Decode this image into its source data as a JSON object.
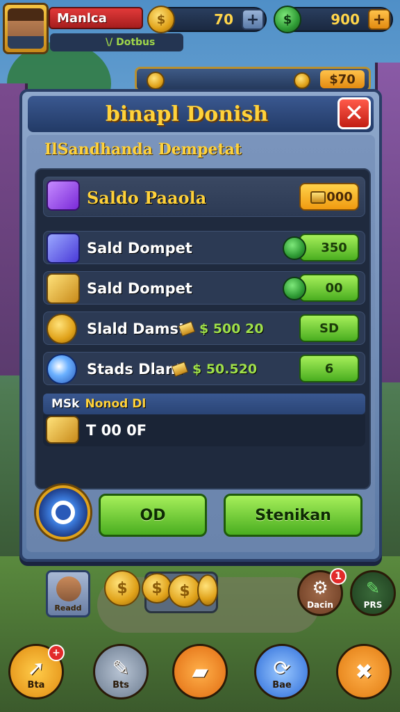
{
  "hud": {
    "player_name": "Manlca",
    "player_subtitle": "\\/ Dotbus",
    "gold": "70",
    "cash": "900",
    "plus_symbol": "+",
    "behind_value": "$70"
  },
  "dialog": {
    "title": "binapl Donish",
    "close_symbol": "✕",
    "section_title": "IlSandhanda Dempetat",
    "rows": [
      {
        "label": "Saldo Paaola",
        "amount": "",
        "button": "000"
      },
      {
        "label": "Sald Dompet",
        "amount": "",
        "button": "350"
      },
      {
        "label": "Sald Dompet",
        "amount": "",
        "button": "00"
      },
      {
        "label": "Slald Damst",
        "amount": "$ 500 20",
        "button": "SD"
      },
      {
        "label": "Stads Dlant",
        "amount": "$ 50.520",
        "button": "6"
      }
    ],
    "subheader_prefix": "MSk",
    "subheader_text": "Nonod Dl",
    "total_label": "T 00 0F",
    "ok_button": "OD",
    "save_button": "Stenikan"
  },
  "bottom": {
    "character_label": "Readd",
    "coin_symbol": "$",
    "side_button_a_label": "Dacin",
    "side_button_a_badge": "1",
    "side_button_b_label": "PRS",
    "nav": [
      {
        "label": "Bta",
        "icon": "arrow-icon",
        "badge": "+"
      },
      {
        "label": "Bts",
        "icon": "wrench-icon"
      },
      {
        "label": "",
        "icon": "gold-bar-icon"
      },
      {
        "label": "Bae",
        "icon": "refresh-icon"
      },
      {
        "label": "",
        "icon": "build-icon"
      }
    ]
  }
}
